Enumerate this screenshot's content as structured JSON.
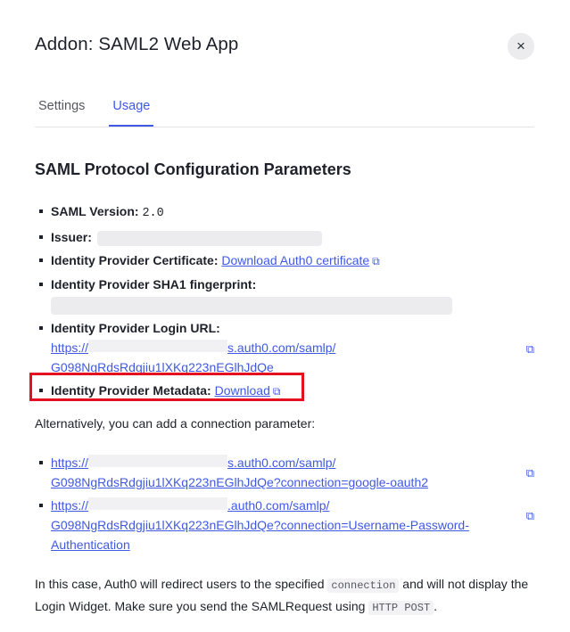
{
  "modal": {
    "title": "Addon: SAML2 Web App",
    "close_icon": "×"
  },
  "tabs": [
    {
      "label": "Settings",
      "active": false
    },
    {
      "label": "Usage",
      "active": true
    }
  ],
  "section_title": "SAML Protocol Configuration Parameters",
  "params": {
    "saml_version": {
      "label": "SAML Version:",
      "value": "2.0"
    },
    "issuer": {
      "label": "Issuer:"
    },
    "certificate": {
      "label": "Identity Provider Certificate:",
      "link": "Download Auth0 certificate"
    },
    "fingerprint": {
      "label": "Identity Provider SHA1 fingerprint:"
    },
    "login_url": {
      "label": "Identity Provider Login URL:",
      "line1_prefix": "https://",
      "line1_suffix": "s.auth0.com/samlp/",
      "line2": "G098NgRdsRdgjiu1lXKq223nEGlhJdQe"
    },
    "metadata": {
      "label": "Identity Provider Metadata:",
      "link": "Download"
    }
  },
  "alt_text": "Alternatively, you can add a connection parameter:",
  "alt_links": [
    {
      "line1_prefix": "https://",
      "line1_suffix": "s.auth0.com/samlp/",
      "line2": "G098NgRdsRdgjiu1lXKq223nEGlhJdQe?connection=google-oauth2"
    },
    {
      "line1_prefix": "https://",
      "line1_suffix": ".auth0.com/samlp/",
      "line2": "G098NgRdsRdgjiu1lXKq223nEGlhJdQe?connection=Username-Password-",
      "line3": "Authentication"
    }
  ],
  "footer": {
    "part1": "In this case, Auth0 will redirect users to the specified",
    "code1": "connection",
    "part2": "and will not display the Login Widget. Make sure you send the SAMLRequest using",
    "code2": "HTTP POST",
    "part3": "."
  },
  "icons": {
    "external_link": "⧉"
  },
  "colors": {
    "accent": "#3f59e4",
    "highlight_box": "#e4101f"
  }
}
